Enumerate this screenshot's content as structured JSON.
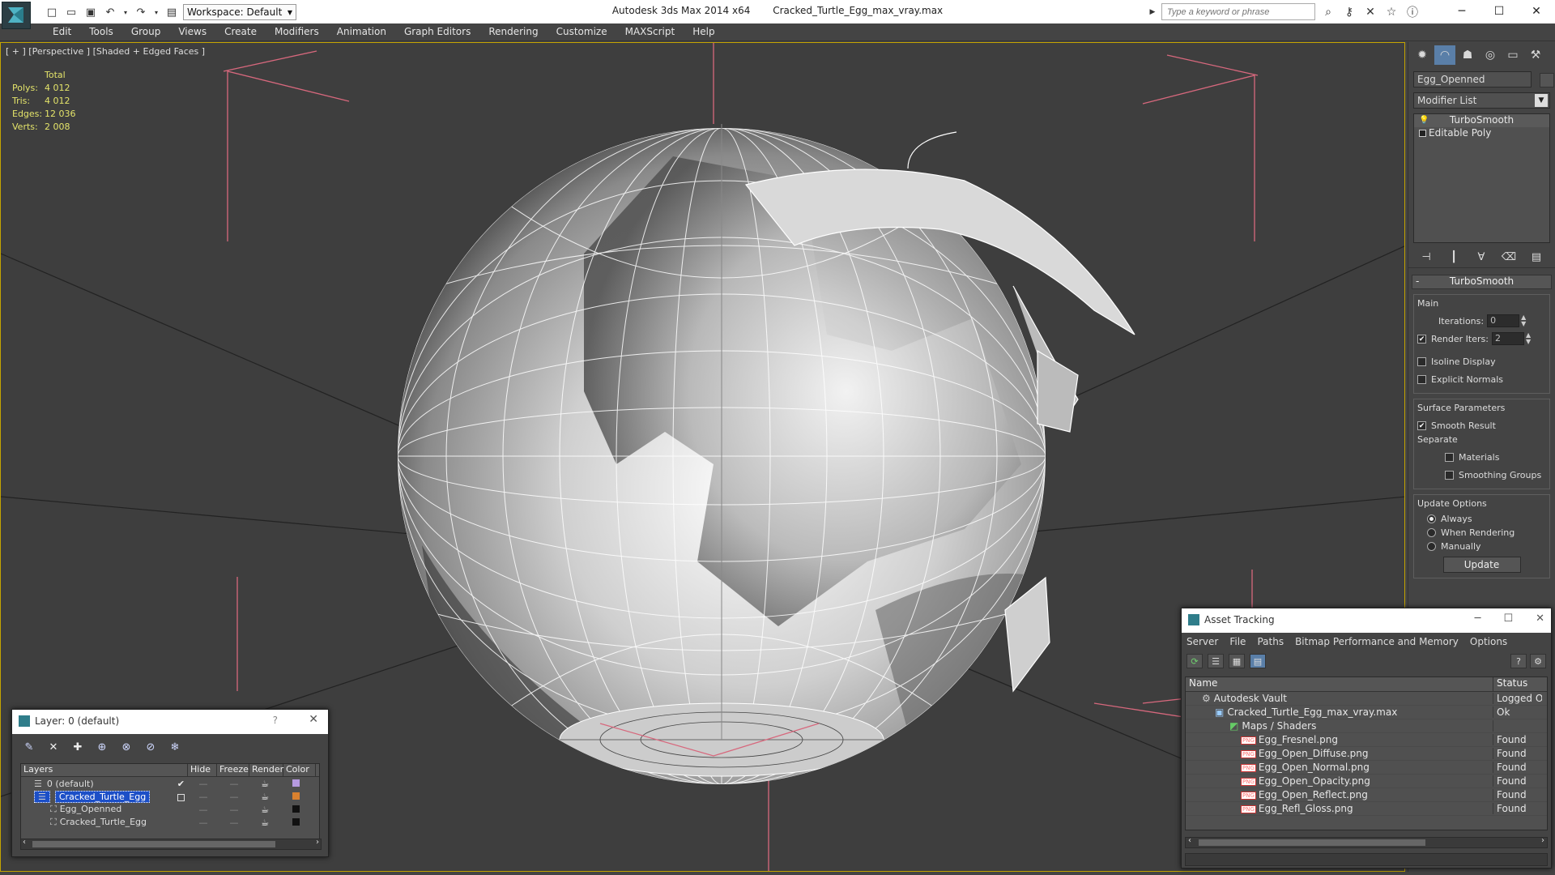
{
  "titlebar": {
    "app_name": "Autodesk 3ds Max  2014 x64",
    "file_name": "Cracked_Turtle_Egg_max_vray.max",
    "workspace": "Workspace: Default",
    "search_placeholder": "Type a keyword or phrase"
  },
  "menu": [
    "Edit",
    "Tools",
    "Group",
    "Views",
    "Create",
    "Modifiers",
    "Animation",
    "Graph Editors",
    "Rendering",
    "Customize",
    "MAXScript",
    "Help"
  ],
  "viewport": {
    "label": "[ + ] [Perspective ] [Shaded + Edged Faces ]",
    "stats": {
      "header": "Total",
      "polys_label": "Polys:",
      "polys": "4 012",
      "tris_label": "Tris:",
      "tris": "4 012",
      "edges_label": "Edges:",
      "edges": "12 036",
      "verts_label": "Verts:",
      "verts": "2 008"
    }
  },
  "command_panel": {
    "object_name": "Egg_Openned",
    "modifier_list": "Modifier List",
    "stack": [
      "TurboSmooth",
      "Editable Poly"
    ],
    "rollout_title": "TurboSmooth",
    "main_title": "Main",
    "iterations_label": "Iterations:",
    "iterations": "0",
    "render_iters_label": "Render Iters:",
    "render_iters": "2",
    "isoline_label": "Isoline Display",
    "explicit_label": "Explicit Normals",
    "surface_title": "Surface Parameters",
    "smooth_result_label": "Smooth Result",
    "separate_label": "Separate",
    "materials_label": "Materials",
    "smoothing_groups_label": "Smoothing Groups",
    "update_title": "Update Options",
    "always_label": "Always",
    "when_rendering_label": "When Rendering",
    "manually_label": "Manually",
    "update_button": "Update"
  },
  "layer_dialog": {
    "title": "Layer: 0 (default)",
    "help": "?",
    "columns": [
      "Layers",
      "Hide",
      "Freeze",
      "Render",
      "Color"
    ],
    "rows": [
      {
        "name": "0 (default)",
        "color": "#b69ae0"
      },
      {
        "name": "Cracked_Turtle_Egg",
        "color": "#d9812f"
      },
      {
        "name": "Egg_Openned",
        "color": "#111111"
      },
      {
        "name": "Cracked_Turtle_Egg",
        "color": "#111111"
      }
    ]
  },
  "asset_dialog": {
    "title": "Asset Tracking",
    "menu": [
      "Server",
      "File",
      "Paths",
      "Bitmap Performance and Memory",
      "Options"
    ],
    "columns": [
      "Name",
      "Status"
    ],
    "rows": [
      {
        "name": "Autodesk Vault",
        "status": "Logged Ou"
      },
      {
        "name": "Cracked_Turtle_Egg_max_vray.max",
        "status": "Ok"
      },
      {
        "name": "Maps / Shaders",
        "status": ""
      },
      {
        "name": "Egg_Fresnel.png",
        "status": "Found"
      },
      {
        "name": "Egg_Open_Diffuse.png",
        "status": "Found"
      },
      {
        "name": "Egg_Open_Normal.png",
        "status": "Found"
      },
      {
        "name": "Egg_Open_Opacity.png",
        "status": "Found"
      },
      {
        "name": "Egg_Open_Reflect.png",
        "status": "Found"
      },
      {
        "name": "Egg_Refl_Gloss.png",
        "status": "Found"
      }
    ]
  },
  "colors": {
    "viewport_border": "#c4a400",
    "stats_text": "#e4e46a",
    "selection": "#1c4fc7",
    "active_tab": "#5a7fa8"
  }
}
